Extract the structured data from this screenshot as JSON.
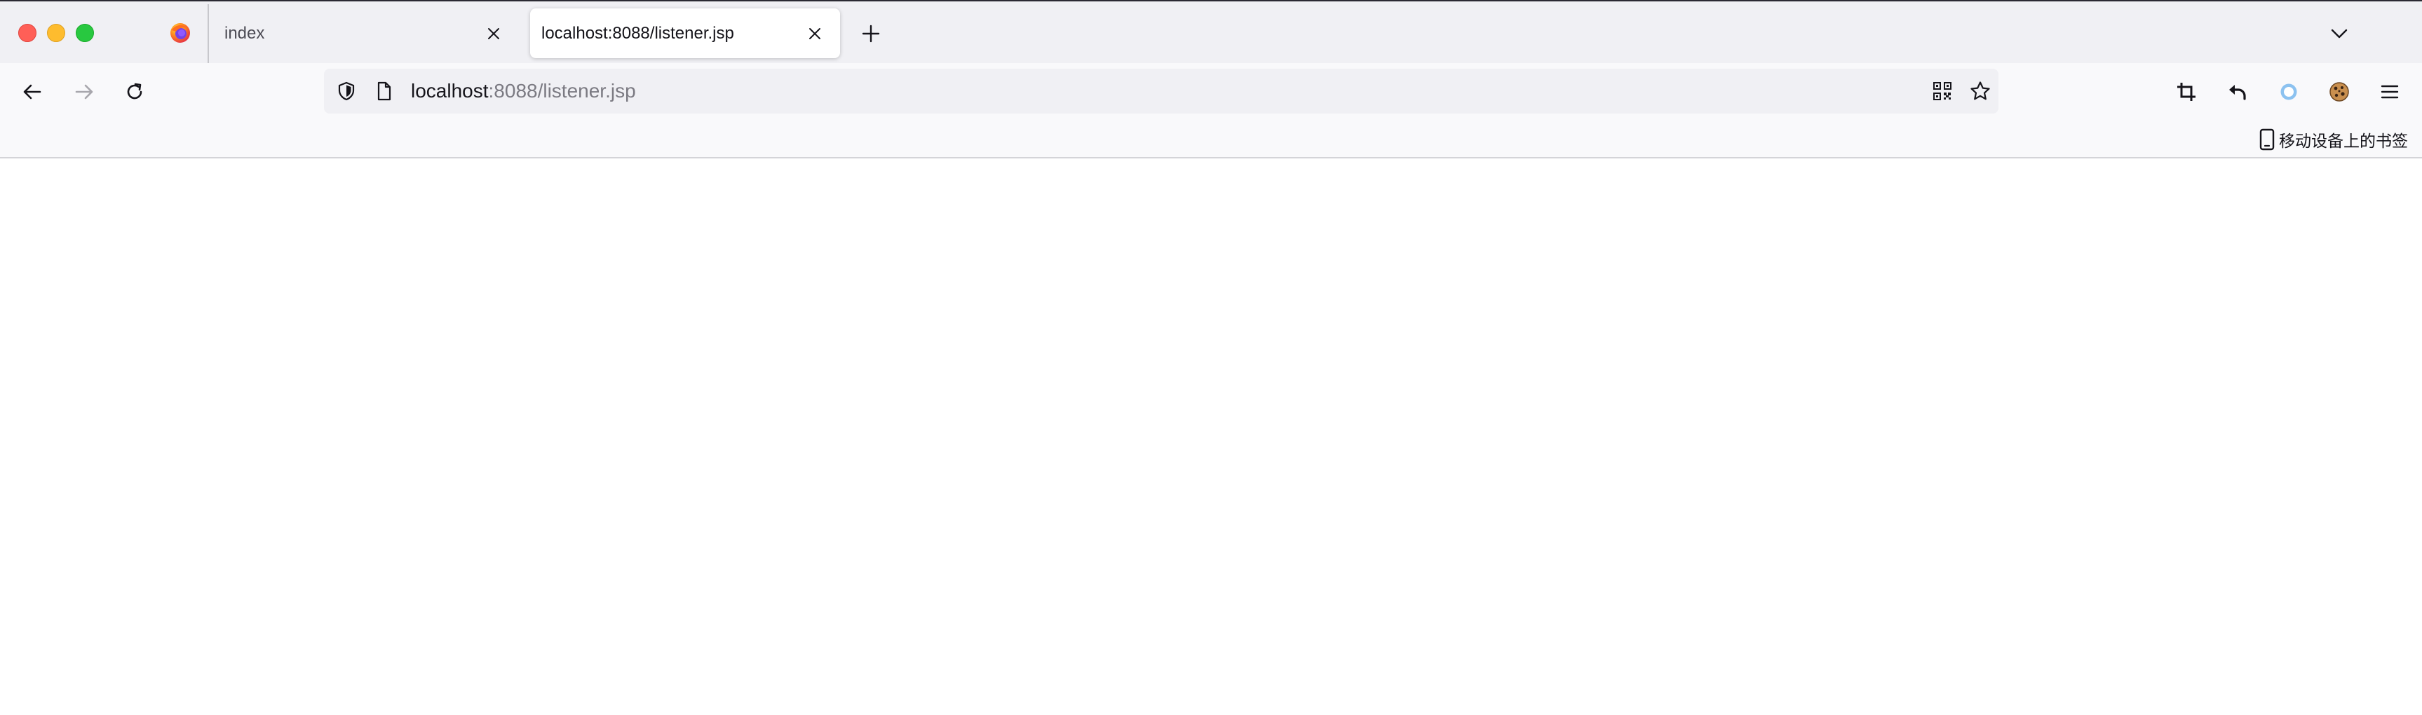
{
  "window": {
    "controls": [
      "close",
      "minimize",
      "maximize"
    ]
  },
  "tabs": [
    {
      "title": "index",
      "active": false,
      "icon": "close-icon"
    },
    {
      "title": "localhost:8088/listener.jsp",
      "active": true,
      "icon": "close-icon"
    }
  ],
  "toolbar": {
    "back_icon": "arrow-left-icon",
    "forward_icon": "arrow-right-icon",
    "reload_icon": "reload-icon",
    "new_tab_icon": "plus-icon",
    "tab_list_icon": "chevron-down-icon"
  },
  "urlbar": {
    "host": "localhost",
    "rest": ":8088/listener.jsp",
    "left_icons": [
      "shield-icon",
      "page-icon"
    ],
    "right_icons": [
      "qr-code-icon",
      "star-icon"
    ]
  },
  "extensions": [
    "crop-icon",
    "undo-icon",
    "ring-icon",
    "cookie-icon",
    "menu-icon"
  ],
  "bookmarks": {
    "mobile_label": "移动设备上的书签",
    "icon": "mobile-device-icon"
  },
  "colors": {
    "tabstrip_bg": "#f0f0f4",
    "toolbar_bg": "#f9f9fb",
    "active_tab_bg": "#ffffff",
    "close_light": "#ff5f57",
    "min_light": "#febc2e",
    "max_light": "#28c840",
    "ring_accent": "#8cc2f0"
  }
}
